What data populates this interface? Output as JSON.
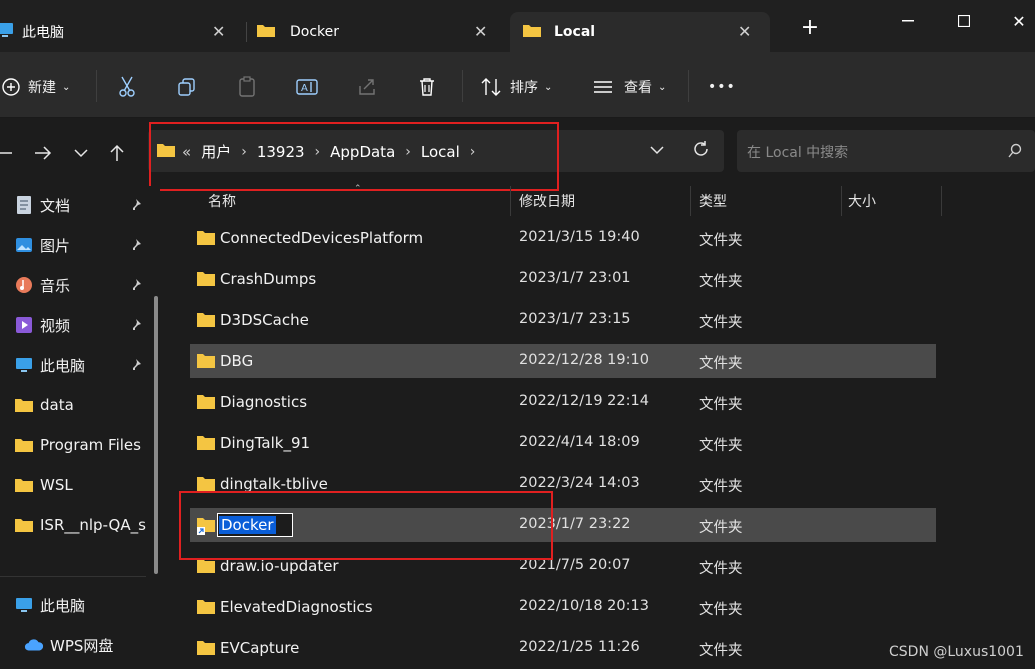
{
  "tabs": [
    {
      "label": "此电脑",
      "icon": "this-pc-icon"
    },
    {
      "label": "Docker",
      "icon": "folder-icon"
    },
    {
      "label": "Local",
      "icon": "folder-icon"
    }
  ],
  "toolbar": {
    "new_label": "新建",
    "sort_label": "排序",
    "view_label": "查看",
    "more_label": "•••"
  },
  "address": {
    "overflow": "«",
    "crumbs": [
      "用户",
      "13923",
      "AppData",
      "Local"
    ],
    "search_placeholder": "在 Local 中搜索"
  },
  "sidebar": {
    "items": [
      {
        "label": "文档",
        "icon": "documents-icon",
        "pinned": true
      },
      {
        "label": "图片",
        "icon": "pictures-icon",
        "pinned": true
      },
      {
        "label": "音乐",
        "icon": "music-icon",
        "pinned": true
      },
      {
        "label": "视频",
        "icon": "videos-icon",
        "pinned": true
      },
      {
        "label": "此电脑",
        "icon": "this-pc-icon",
        "pinned": true
      },
      {
        "label": "data",
        "icon": "folder-icon",
        "pinned": false
      },
      {
        "label": "Program Files",
        "icon": "folder-icon",
        "pinned": false
      },
      {
        "label": "WSL",
        "icon": "folder-icon",
        "pinned": false
      },
      {
        "label": "ISR__nlp-QA_st",
        "icon": "folder-icon",
        "pinned": false
      }
    ],
    "bottom_items": [
      {
        "label": "此电脑",
        "icon": "this-pc-icon"
      },
      {
        "label": "WPS网盘",
        "icon": "cloud-icon"
      }
    ]
  },
  "columns": {
    "name": "名称",
    "date": "修改日期",
    "type": "类型",
    "size": "大小"
  },
  "files": [
    {
      "name": "ConnectedDevicesPlatform",
      "date": "2021/3/15 19:40",
      "type": "文件夹"
    },
    {
      "name": "CrashDumps",
      "date": "2023/1/7 23:01",
      "type": "文件夹"
    },
    {
      "name": "D3DSCache",
      "date": "2023/1/7 23:15",
      "type": "文件夹"
    },
    {
      "name": "DBG",
      "date": "2022/12/28 19:10",
      "type": "文件夹"
    },
    {
      "name": "Diagnostics",
      "date": "2022/12/19 22:14",
      "type": "文件夹"
    },
    {
      "name": "DingTalk_91",
      "date": "2022/4/14 18:09",
      "type": "文件夹"
    },
    {
      "name": "dingtalk-tblive",
      "date": "2022/3/24 14:03",
      "type": "文件夹"
    },
    {
      "name": "Docker",
      "date": "2023/1/7 23:22",
      "type": "文件夹"
    },
    {
      "name": "draw.io-updater",
      "date": "2021/7/5 20:07",
      "type": "文件夹"
    },
    {
      "name": "ElevatedDiagnostics",
      "date": "2022/10/18 20:13",
      "type": "文件夹"
    },
    {
      "name": "EVCapture",
      "date": "2022/1/25 11:26",
      "type": "文件夹"
    }
  ],
  "watermark": "CSDN @Luxus1001",
  "colors": {
    "folder": "#f4c542",
    "selection": "#0a5ed8",
    "highlight": "#e02020"
  }
}
